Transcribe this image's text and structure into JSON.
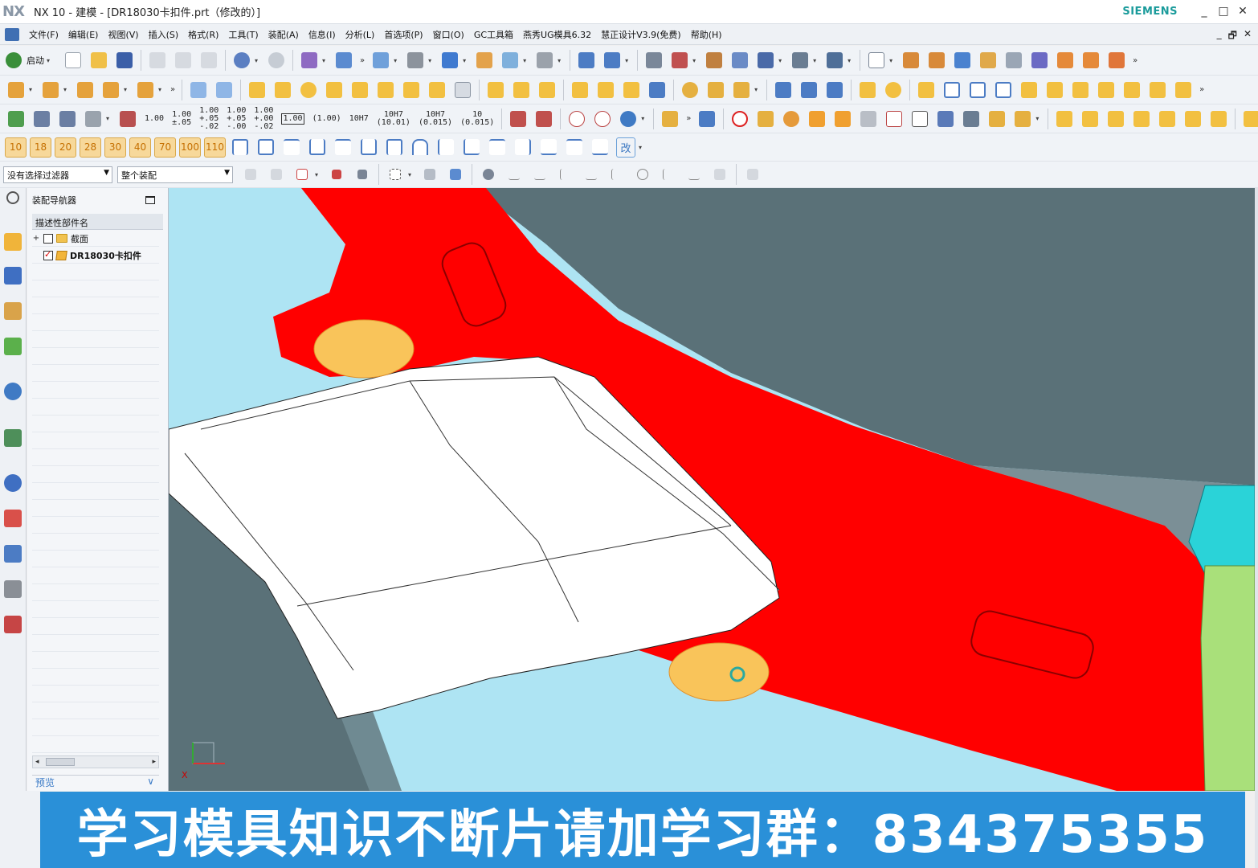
{
  "window": {
    "logo": "NX",
    "title": "NX 10 - 建模 - [DR18030卡扣件.prt（修改的）]",
    "brand": "SIEMENS",
    "controls": [
      "_",
      "□",
      "✕"
    ]
  },
  "menu": {
    "items": [
      "文件(F)",
      "编辑(E)",
      "视图(V)",
      "插入(S)",
      "格式(R)",
      "工具(T)",
      "装配(A)",
      "信息(I)",
      "分析(L)",
      "首选项(P)",
      "窗口(O)",
      "GC工具箱",
      "燕秀UG模具6.32",
      "慧正设计V3.9(免费)",
      "帮助(H)"
    ],
    "mdi": [
      "_",
      "🗗",
      "✕"
    ]
  },
  "toolbar1": {
    "start_label": "启动"
  },
  "toolbar3": {
    "dims": [
      "1.00",
      "1.00\n±.05",
      "1.00\n+.05\n-.02",
      "1.00\n+.05\n-.00",
      "1.00\n+.00\n-.02",
      "1.00",
      "(1.00)",
      "10H7",
      "10H7\n(10.01)",
      "10H7\n(0.015)",
      "10\n(0.015)"
    ]
  },
  "toolbar4": {
    "numbers": [
      "10",
      "18",
      "20",
      "28",
      "30",
      "40",
      "70",
      "100",
      "110"
    ],
    "gai": "改"
  },
  "toolbar5": {
    "filter": "没有选择过滤器",
    "scope": "整个装配"
  },
  "navigator": {
    "title": "装配导航器",
    "column": "描述性部件名",
    "rows": [
      {
        "expander": "+",
        "checked": false,
        "label": "截面"
      },
      {
        "expander": "",
        "checked": true,
        "label": "DR18030卡扣件"
      }
    ],
    "preview_label": "预览"
  },
  "viewport": {
    "axis_label": "X"
  },
  "banner": {
    "text": "学习模具知识不断片请加学习群：834375355"
  },
  "colors": {
    "background": "#aee4f3",
    "red_part": "#ff0000",
    "white_part": "#ffffff",
    "dark_part": "#5a7178",
    "highlight_face": "#f9c45a",
    "cyan_part": "#2ad3d8",
    "green_part": "#a9e07a",
    "banner": "#2a90d8"
  }
}
